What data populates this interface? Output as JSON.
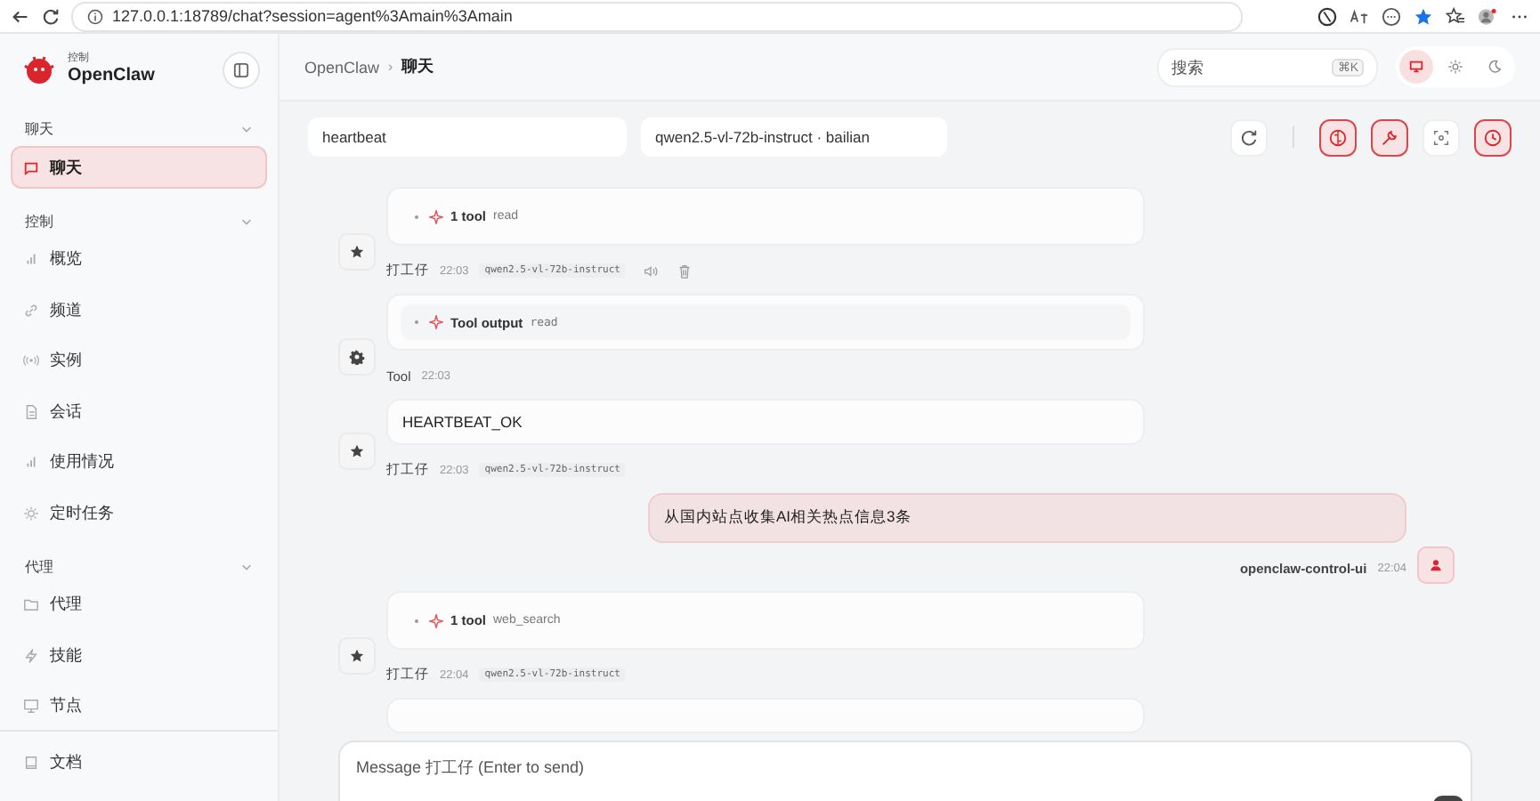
{
  "browser": {
    "url": "127.0.0.1:18789/chat?session=agent%3Amain%3Amain"
  },
  "sidebar": {
    "brand_caption": "控制",
    "brand_name": "OpenClaw",
    "sections": [
      {
        "label": "聊天",
        "expanded": true,
        "items": [
          {
            "label": "聊天",
            "selected": true
          }
        ]
      },
      {
        "label": "控制",
        "expanded": true,
        "items": [
          {
            "label": "概览",
            "selected": false
          },
          {
            "label": "频道",
            "selected": false
          },
          {
            "label": "实例",
            "selected": false
          },
          {
            "label": "会话",
            "selected": false
          },
          {
            "label": "使用情况",
            "selected": false
          },
          {
            "label": "定时任务",
            "selected": false
          }
        ]
      },
      {
        "label": "代理",
        "expanded": true,
        "items": [
          {
            "label": "代理",
            "selected": false
          },
          {
            "label": "技能",
            "selected": false
          },
          {
            "label": "节点",
            "selected": false
          }
        ]
      }
    ],
    "footer_item": {
      "label": "文档"
    }
  },
  "header": {
    "breadcrumb": [
      "OpenClaw",
      "聊天"
    ],
    "breadcrumb_separator": "›",
    "search": {
      "placeholder": "搜索",
      "shortcut": "⌘K"
    },
    "theme_modes": [
      {
        "kind": "system",
        "selected": true
      },
      {
        "kind": "light",
        "selected": false
      },
      {
        "kind": "dark",
        "selected": false
      }
    ]
  },
  "toolbar": {
    "session": "heartbeat",
    "model": "qwen2.5-vl-72b-instruct · bailian",
    "toggles": [
      {
        "kind": "thinking",
        "on": true
      },
      {
        "kind": "tools",
        "on": true
      },
      {
        "kind": "focus",
        "on": false
      },
      {
        "kind": "history",
        "on": true
      }
    ]
  },
  "messages": [
    {
      "kind": "assistant",
      "parts": [
        {
          "kind": "tool_call",
          "count": "1 tool",
          "name": "read"
        }
      ],
      "author": "打工仔",
      "time": "22:03",
      "model": "qwen2.5-vl-72b-instruct",
      "actions_visible": true
    },
    {
      "kind": "tool",
      "parts": [
        {
          "kind": "tool_output",
          "title": "Tool output",
          "name": "read"
        }
      ],
      "author": "Tool",
      "time": "22:03",
      "actions_visible": false
    },
    {
      "kind": "assistant",
      "parts": [
        {
          "kind": "text",
          "text": "HEARTBEAT_OK"
        }
      ],
      "author": "打工仔",
      "time": "22:03",
      "model": "qwen2.5-vl-72b-instruct",
      "actions_visible": false
    },
    {
      "kind": "user",
      "parts": [
        {
          "kind": "text",
          "text": "从国内站点收集AI相关热点信息3条"
        }
      ],
      "author": "openclaw-control-ui",
      "time": "22:04",
      "actions_visible": false
    },
    {
      "kind": "assistant",
      "parts": [
        {
          "kind": "tool_call",
          "count": "1 tool",
          "name": "web_search"
        }
      ],
      "author": "打工仔",
      "time": "22:04",
      "model": "qwen2.5-vl-72b-instruct",
      "actions_visible": false
    },
    {
      "kind": "tool",
      "parts": [
        {
          "kind": "tool_output_hidden"
        }
      ]
    }
  ],
  "composer": {
    "placeholder": "Message 打工仔 (Enter to send)"
  }
}
